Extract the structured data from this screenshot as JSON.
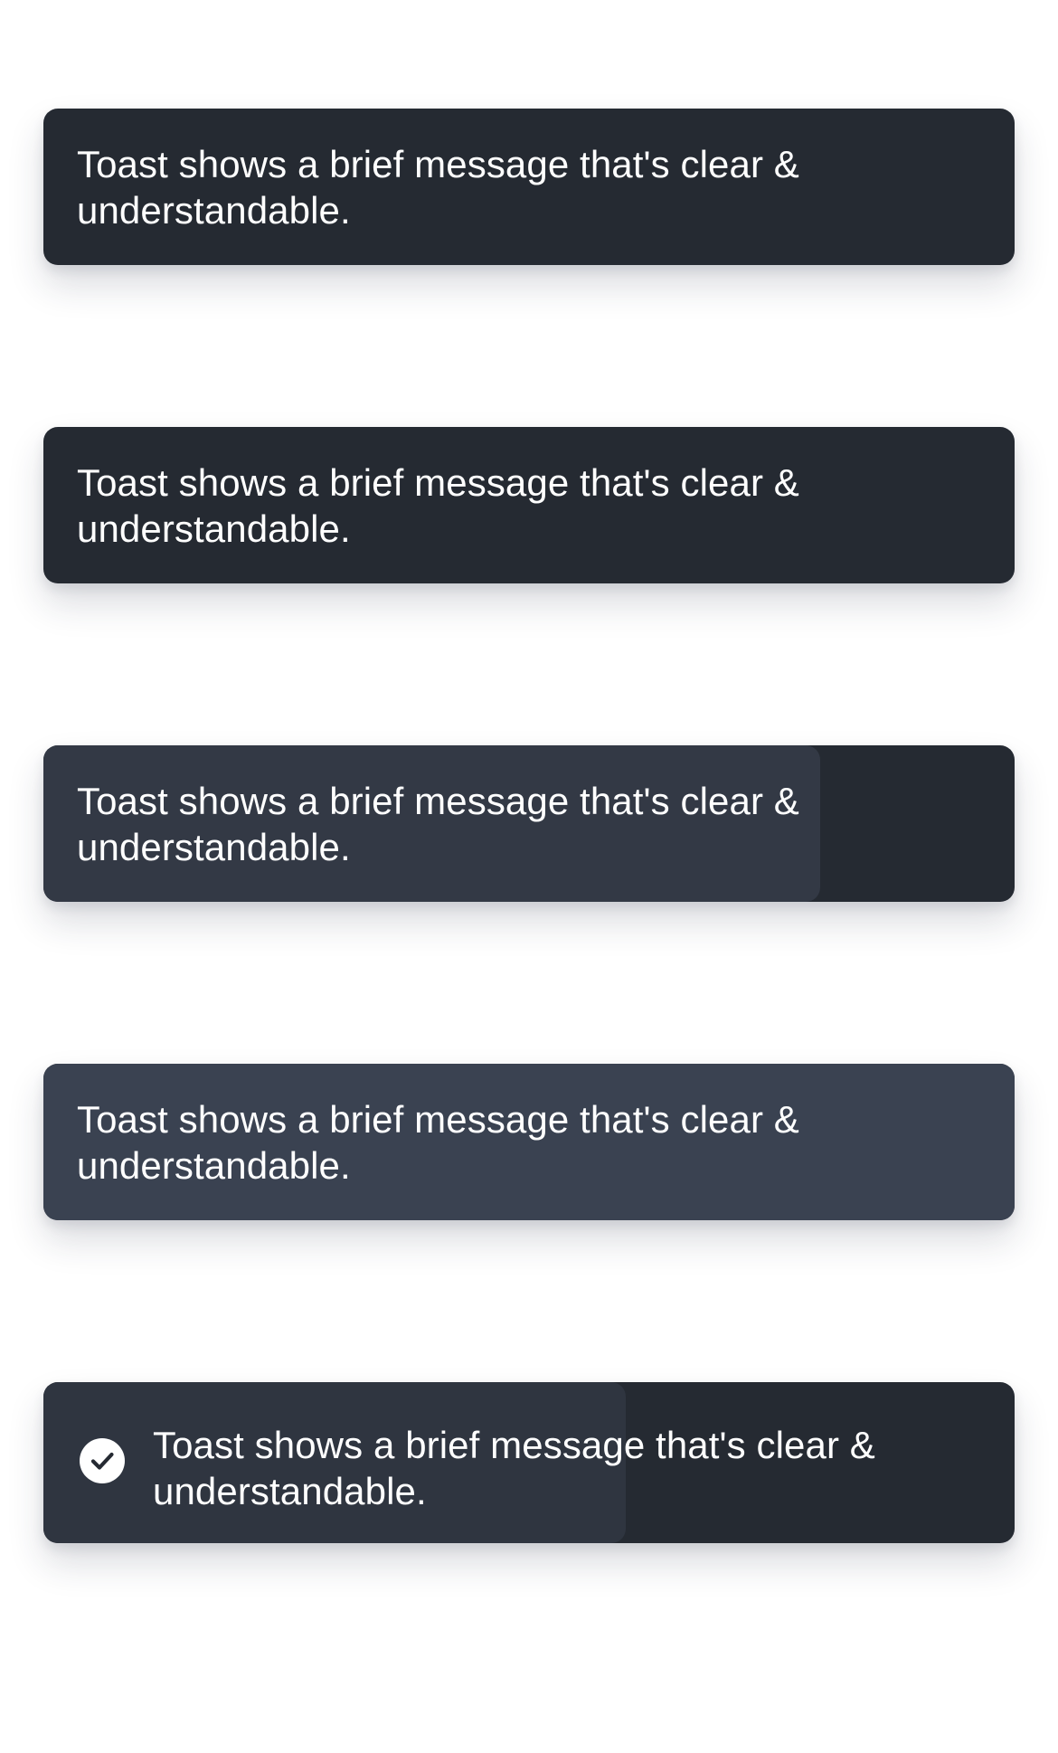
{
  "colors": {
    "page_background": "#ffffff",
    "toast_background": "#252a32",
    "toast_text": "#ffffff",
    "progress_fill_medium": "#333945",
    "progress_fill_full": "#3a4251",
    "progress_fill_icon_variant": "#2f3540"
  },
  "toasts": [
    {
      "message": "Toast shows a brief message that's clear & understandable.",
      "progress": 0.0,
      "icon": null
    },
    {
      "message": "Toast shows a brief message that's clear & understandable.",
      "progress": 0.0,
      "icon": null
    },
    {
      "message": "Toast shows a brief message that's clear & understandable.",
      "progress": 0.8,
      "icon": null
    },
    {
      "message": "Toast shows a brief message that's clear & understandable.",
      "progress": 1.0,
      "icon": null
    },
    {
      "message": "Toast shows a brief message that's clear & understandable.",
      "progress": 0.6,
      "icon": "check-circle-icon"
    }
  ]
}
